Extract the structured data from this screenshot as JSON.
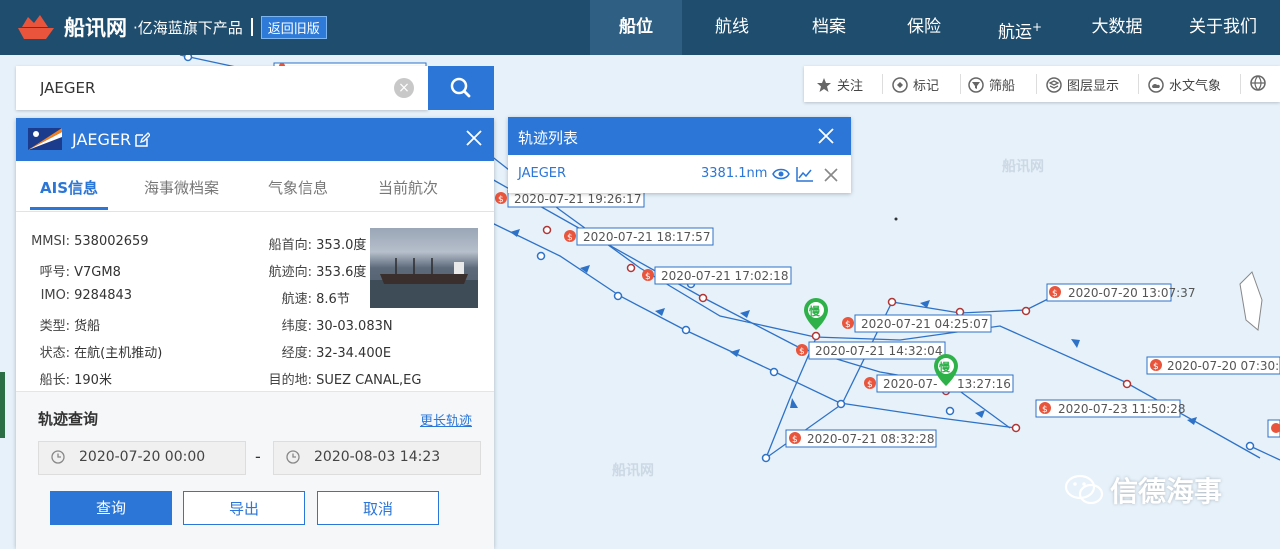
{
  "app": {
    "logo_name": "船讯网",
    "logo_sub": "·亿海蓝旗下产品",
    "old_version": "返回旧版"
  },
  "nav": [
    {
      "label": "船位",
      "active": true
    },
    {
      "label": "航线",
      "active": false
    },
    {
      "label": "档案",
      "active": false
    },
    {
      "label": "保险",
      "active": false
    },
    {
      "label": "航运",
      "sup": "+",
      "active": false
    },
    {
      "label": "大数据",
      "active": false
    },
    {
      "label": "关于我们",
      "active": false
    }
  ],
  "search": {
    "value": "JAEGER"
  },
  "ship": {
    "name": "JAEGER",
    "tabs": [
      "AIS信息",
      "海事微档案",
      "气象信息",
      "当前航次"
    ],
    "left": [
      {
        "k": "MMSI:",
        "v": "538002659"
      },
      {
        "k": "呼号:",
        "v": "V7GM8"
      },
      {
        "k": "IMO:",
        "v": "9284843"
      },
      {
        "k": "类型:",
        "v": "货船"
      },
      {
        "k": "状态:",
        "v": "在航(主机推动)"
      },
      {
        "k": "船长:",
        "v": "190米"
      }
    ],
    "right": [
      {
        "k": "船首向:",
        "v": "353.0度"
      },
      {
        "k": "航迹向:",
        "v": "353.6度"
      },
      {
        "k": "航速:",
        "v": "8.6节"
      },
      {
        "k": "纬度:",
        "v": "30-03.083N"
      },
      {
        "k": "经度:",
        "v": "32-34.400E"
      },
      {
        "k": "目的地:",
        "v": "SUEZ CANAL,EG"
      }
    ]
  },
  "track": {
    "title": "轨迹查询",
    "more": "更长轨迹",
    "start": "2020-07-20 00:00",
    "dash": "-",
    "end": "2020-08-03 14:23",
    "query": "查询",
    "export": "导出",
    "cancel": "取消"
  },
  "traj": {
    "title": "轨迹列表",
    "name": "JAEGER",
    "distance": "3381.1nm"
  },
  "toolbar": [
    "关注",
    "标记",
    "筛船",
    "图层显示",
    "水文气象"
  ],
  "map": {
    "labels": [
      {
        "t": "2020-07-21 19:26:17"
      },
      {
        "t": "2020-07-21 18:17:57"
      },
      {
        "t": "2020-07-21 17:02:18"
      },
      {
        "t": "2020-07-21 04:25:07"
      },
      {
        "t": "2020-07-21 14:32:04"
      },
      {
        "t": "2020-07-"
      },
      {
        "t": "13:27:16"
      },
      {
        "t": "2020-07-21 08:32:28"
      },
      {
        "t": "2020-07-20 13:07:37"
      },
      {
        "t": "2020-07-23 11:50:28"
      },
      {
        "t": "2020-07-20 07:30:"
      }
    ],
    "slow_marker": "慢",
    "tile_watermark": "船讯网",
    "watermark": "信德海事"
  },
  "colors": {
    "topbar": "#1f4d6e",
    "accent": "#2b76d6",
    "track": "#2e72c7",
    "marker": "#e8553c",
    "slow": "#2fb14a"
  }
}
